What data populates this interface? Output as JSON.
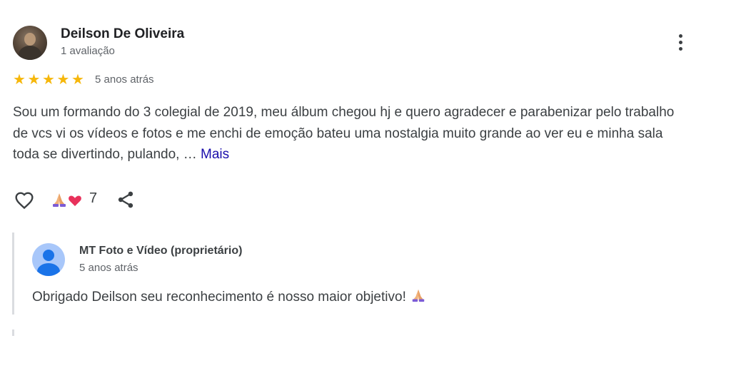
{
  "review": {
    "reviewer_name": "Deilson De Oliveira",
    "review_count": "1 avaliação",
    "rating": 5,
    "rating_stars": "★★★★★",
    "time_ago": "5 anos atrás",
    "text": "Sou um formando do 3 colegial de 2019, meu álbum chegou hj e quero agradecer e parabenizar pelo trabalho de vcs vi os vídeos e fotos e me enchi de emoção bateu uma nostalgia muito grande ao ver eu e minha sala toda se divertindo, pulando, … ",
    "more_label": "Mais",
    "reactions": [
      "pray-emoji",
      "heart-emoji"
    ],
    "reaction_count": "7",
    "icons": {
      "avatar": "user-photo",
      "menu": "more-vert-icon",
      "like": "heart-outline-icon",
      "share": "share-icon"
    }
  },
  "owner_reply": {
    "name": "MT Foto e Vídeo (proprietário)",
    "time_ago": "5 anos atrás",
    "text": "Obrigado Deilson seu reconhecimento é nosso maior objetivo!",
    "emoji": "pray-emoji",
    "avatar_icon": "default-user-icon"
  },
  "colors": {
    "star": "#f6b70b",
    "link": "#1a0dab",
    "text": "#3c4043",
    "muted": "#5f6368",
    "divider": "#dadce0"
  }
}
